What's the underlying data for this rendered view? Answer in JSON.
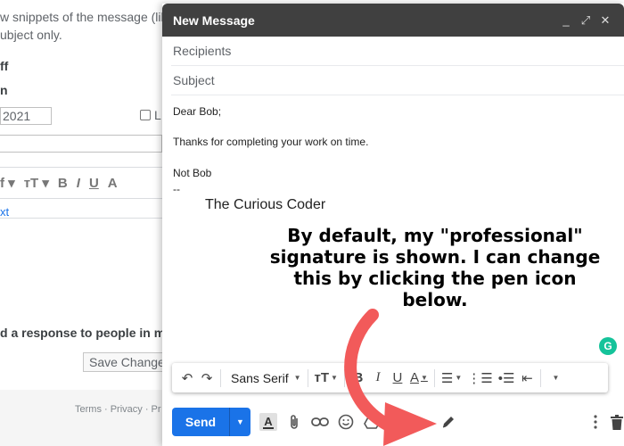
{
  "background": {
    "snippet_line1": "w snippets of the message (like",
    "snippet_line2": "ubject only.",
    "label_ff": "ff",
    "label_n": "n",
    "date_value": "2021",
    "checkbox_letter": "L",
    "link_text": "xt",
    "response_text": "d a response to people in my C",
    "save_button": "Save Changes",
    "footer": "Terms · Privacy · Pr"
  },
  "compose": {
    "title": "New Message",
    "recipients_placeholder": "Recipients",
    "subject_placeholder": "Subject",
    "body": {
      "greeting": "Dear Bob;",
      "line1": "Thanks for completing your work on time.",
      "closing": "Not Bob",
      "sig_sep": "--",
      "signature": "The Curious Coder"
    }
  },
  "annotation": {
    "line1": "By default, my \"professional\"",
    "line2": "signature is shown. I can change",
    "line3": "this by clicking the pen icon",
    "line4": "below.",
    "arrow_color": "#f25a5a"
  },
  "toolbar": {
    "font": "Sans Serif"
  },
  "actions": {
    "send_label": "Send"
  },
  "colors": {
    "send_blue": "#1a73e8",
    "header_dark": "#404040",
    "grammarly_green": "#15c39a"
  }
}
